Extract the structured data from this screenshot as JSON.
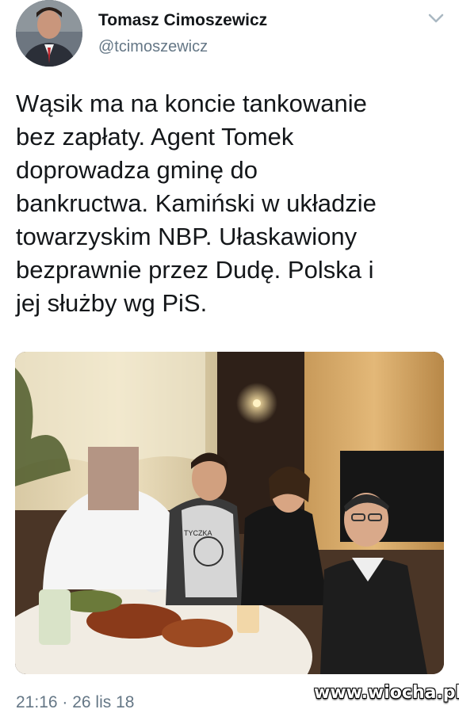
{
  "author": {
    "name": "Tomasz Cimoszewicz",
    "handle": "@tcimoszewicz"
  },
  "tweet": {
    "text": "Wąsik ma na koncie tankowanie\nbez zapłaty. Agent Tomek\ndoprowadza gminę do\nbankructwa. Kamiński w układzie\ntowarzyskim NBP. Ułaskawiony\nbezprawnie przez Dudę. Polska i\njej służby wg PiS.",
    "timestamp": "21:16 · 26 lis 18"
  },
  "photo": {
    "shirt_print": "TYCZKA"
  },
  "watermark": "www.wiocha.pl",
  "colors": {
    "text": "#14171a",
    "secondary": "#657786",
    "chevron": "#aab8c2"
  },
  "icons": {
    "more": "chevron-down-icon"
  }
}
